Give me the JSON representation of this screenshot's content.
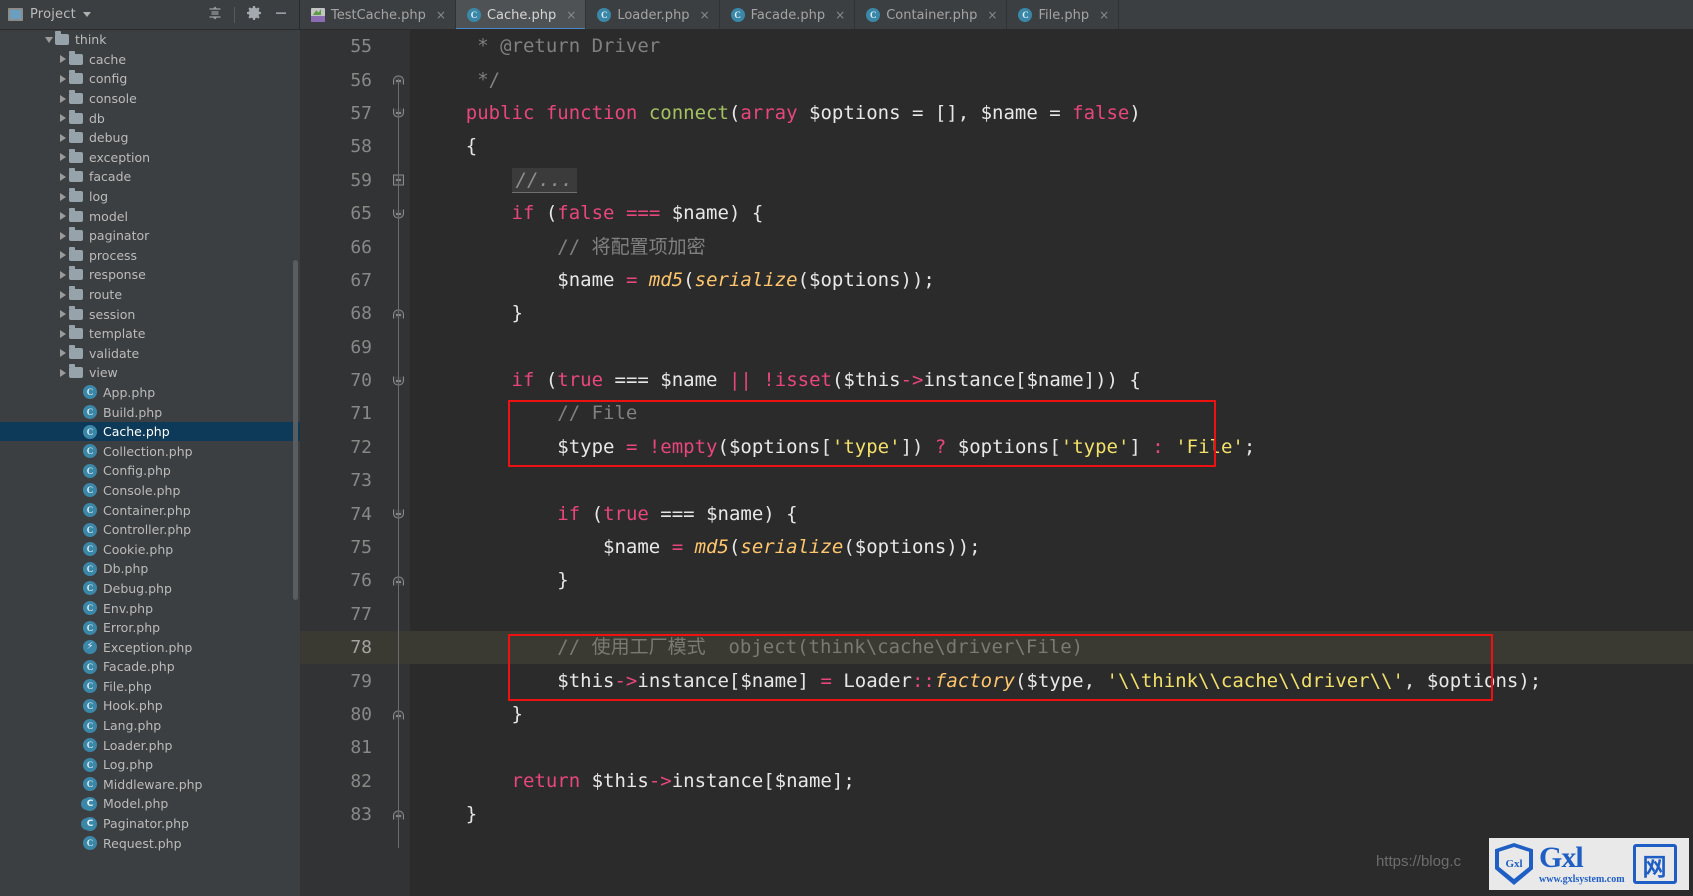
{
  "window": {
    "project_panel_title": "Project",
    "toolbar_icons": [
      "collapse-all-icon",
      "settings-gear-icon",
      "hide-panel-icon"
    ]
  },
  "tabs": [
    {
      "label": "TestCache.php",
      "icon": "php-file-icon",
      "active": false,
      "close": "×"
    },
    {
      "label": "Cache.php",
      "icon": "php-class-icon",
      "active": true,
      "close": "×"
    },
    {
      "label": "Loader.php",
      "icon": "php-class-icon",
      "active": false,
      "close": "×"
    },
    {
      "label": "Facade.php",
      "icon": "php-class-icon",
      "active": false,
      "close": "×"
    },
    {
      "label": "Container.php",
      "icon": "php-class-icon",
      "active": false,
      "close": "×"
    },
    {
      "label": "File.php",
      "icon": "php-class-icon",
      "active": false,
      "close": "×"
    }
  ],
  "sidebar": {
    "items": [
      {
        "label": "think",
        "kind": "folder",
        "indent": 3,
        "expanded": true,
        "selected": false
      },
      {
        "label": "cache",
        "kind": "folder",
        "indent": 4,
        "expanded": false,
        "selected": false
      },
      {
        "label": "config",
        "kind": "folder",
        "indent": 4,
        "expanded": false,
        "selected": false
      },
      {
        "label": "console",
        "kind": "folder",
        "indent": 4,
        "expanded": false,
        "selected": false
      },
      {
        "label": "db",
        "kind": "folder",
        "indent": 4,
        "expanded": false,
        "selected": false
      },
      {
        "label": "debug",
        "kind": "folder",
        "indent": 4,
        "expanded": false,
        "selected": false
      },
      {
        "label": "exception",
        "kind": "folder",
        "indent": 4,
        "expanded": false,
        "selected": false
      },
      {
        "label": "facade",
        "kind": "folder",
        "indent": 4,
        "expanded": false,
        "selected": false
      },
      {
        "label": "log",
        "kind": "folder",
        "indent": 4,
        "expanded": false,
        "selected": false
      },
      {
        "label": "model",
        "kind": "folder",
        "indent": 4,
        "expanded": false,
        "selected": false
      },
      {
        "label": "paginator",
        "kind": "folder",
        "indent": 4,
        "expanded": false,
        "selected": false
      },
      {
        "label": "process",
        "kind": "folder",
        "indent": 4,
        "expanded": false,
        "selected": false
      },
      {
        "label": "response",
        "kind": "folder",
        "indent": 4,
        "expanded": false,
        "selected": false
      },
      {
        "label": "route",
        "kind": "folder",
        "indent": 4,
        "expanded": false,
        "selected": false
      },
      {
        "label": "session",
        "kind": "folder",
        "indent": 4,
        "expanded": false,
        "selected": false
      },
      {
        "label": "template",
        "kind": "folder",
        "indent": 4,
        "expanded": false,
        "selected": false
      },
      {
        "label": "validate",
        "kind": "folder",
        "indent": 4,
        "expanded": false,
        "selected": false
      },
      {
        "label": "view",
        "kind": "folder",
        "indent": 4,
        "expanded": false,
        "selected": false
      },
      {
        "label": "App.php",
        "kind": "class",
        "indent": 5,
        "selected": false
      },
      {
        "label": "Build.php",
        "kind": "class",
        "indent": 5,
        "selected": false
      },
      {
        "label": "Cache.php",
        "kind": "class",
        "indent": 5,
        "selected": true
      },
      {
        "label": "Collection.php",
        "kind": "class",
        "indent": 5,
        "selected": false
      },
      {
        "label": "Config.php",
        "kind": "class",
        "indent": 5,
        "selected": false
      },
      {
        "label": "Console.php",
        "kind": "class",
        "indent": 5,
        "selected": false
      },
      {
        "label": "Container.php",
        "kind": "class",
        "indent": 5,
        "selected": false
      },
      {
        "label": "Controller.php",
        "kind": "class",
        "indent": 5,
        "selected": false
      },
      {
        "label": "Cookie.php",
        "kind": "class",
        "indent": 5,
        "selected": false
      },
      {
        "label": "Db.php",
        "kind": "class",
        "indent": 5,
        "selected": false
      },
      {
        "label": "Debug.php",
        "kind": "class",
        "indent": 5,
        "selected": false
      },
      {
        "label": "Env.php",
        "kind": "class",
        "indent": 5,
        "selected": false
      },
      {
        "label": "Error.php",
        "kind": "class",
        "indent": 5,
        "selected": false
      },
      {
        "label": "Exception.php",
        "kind": "exception",
        "indent": 5,
        "selected": false
      },
      {
        "label": "Facade.php",
        "kind": "class",
        "indent": 5,
        "selected": false
      },
      {
        "label": "File.php",
        "kind": "class",
        "indent": 5,
        "selected": false
      },
      {
        "label": "Hook.php",
        "kind": "class",
        "indent": 5,
        "selected": false
      },
      {
        "label": "Lang.php",
        "kind": "class",
        "indent": 5,
        "selected": false
      },
      {
        "label": "Loader.php",
        "kind": "class",
        "indent": 5,
        "selected": false
      },
      {
        "label": "Log.php",
        "kind": "class",
        "indent": 5,
        "selected": false
      },
      {
        "label": "Middleware.php",
        "kind": "class",
        "indent": 5,
        "selected": false
      },
      {
        "label": "Model.php",
        "kind": "abstract",
        "indent": 5,
        "selected": false
      },
      {
        "label": "Paginator.php",
        "kind": "abstract",
        "indent": 5,
        "selected": false
      },
      {
        "label": "Request.php",
        "kind": "class",
        "indent": 5,
        "selected": false
      }
    ]
  },
  "editor": {
    "file": "Cache.php",
    "current_line": 78,
    "lines": [
      {
        "num": "55",
        "fold": "line",
        "tokens": [
          {
            "t": "     * @return Driver",
            "c": "cmt"
          }
        ]
      },
      {
        "num": "56",
        "fold": "cap",
        "tokens": [
          {
            "t": "     */",
            "c": "cmt"
          }
        ]
      },
      {
        "num": "57",
        "fold": "capdown",
        "tokens": [
          {
            "t": "    ",
            "c": "plain"
          },
          {
            "t": "public",
            "c": "kw2"
          },
          {
            "t": " ",
            "c": "plain"
          },
          {
            "t": "function",
            "c": "kw2"
          },
          {
            "t": " ",
            "c": "plain"
          },
          {
            "t": "connect",
            "c": "fn"
          },
          {
            "t": "(",
            "c": "punct"
          },
          {
            "t": "array",
            "c": "kw2"
          },
          {
            "t": " ",
            "c": "plain"
          },
          {
            "t": "$options",
            "c": "var"
          },
          {
            "t": " = [], ",
            "c": "punct"
          },
          {
            "t": "$name",
            "c": "var"
          },
          {
            "t": " = ",
            "c": "punct"
          },
          {
            "t": "false",
            "c": "kw2"
          },
          {
            "t": ")",
            "c": "punct"
          }
        ]
      },
      {
        "num": "58",
        "fold": "none",
        "tokens": [
          {
            "t": "    {",
            "c": "punct"
          }
        ]
      },
      {
        "num": "59",
        "fold": "plus",
        "tokens": [
          {
            "t": "        ",
            "c": "plain"
          },
          {
            "t": "//...",
            "c": "foldph"
          }
        ]
      },
      {
        "num": "65",
        "fold": "capdown",
        "tokens": [
          {
            "t": "        ",
            "c": "plain"
          },
          {
            "t": "if",
            "c": "kw2"
          },
          {
            "t": " (",
            "c": "punct"
          },
          {
            "t": "false",
            "c": "kw2"
          },
          {
            "t": " ",
            "c": "plain"
          },
          {
            "t": "===",
            "c": "kw2"
          },
          {
            "t": " ",
            "c": "plain"
          },
          {
            "t": "$name",
            "c": "var"
          },
          {
            "t": ") {",
            "c": "punct"
          }
        ]
      },
      {
        "num": "66",
        "fold": "none",
        "tokens": [
          {
            "t": "            // 将配置项加密",
            "c": "cmt"
          }
        ]
      },
      {
        "num": "67",
        "fold": "none",
        "tokens": [
          {
            "t": "            ",
            "c": "plain"
          },
          {
            "t": "$name",
            "c": "var"
          },
          {
            "t": " ",
            "c": "plain"
          },
          {
            "t": "=",
            "c": "kw2"
          },
          {
            "t": " ",
            "c": "plain"
          },
          {
            "t": "md5",
            "c": "meth italic"
          },
          {
            "t": "(",
            "c": "punct"
          },
          {
            "t": "serialize",
            "c": "meth italic"
          },
          {
            "t": "(",
            "c": "punct"
          },
          {
            "t": "$options",
            "c": "var"
          },
          {
            "t": "));",
            "c": "punct"
          }
        ]
      },
      {
        "num": "68",
        "fold": "cap",
        "tokens": [
          {
            "t": "        }",
            "c": "punct"
          }
        ]
      },
      {
        "num": "69",
        "fold": "none",
        "tokens": [
          {
            "t": "",
            "c": "plain"
          }
        ]
      },
      {
        "num": "70",
        "fold": "capdown",
        "tokens": [
          {
            "t": "        ",
            "c": "plain"
          },
          {
            "t": "if",
            "c": "kw2"
          },
          {
            "t": " (",
            "c": "punct"
          },
          {
            "t": "true",
            "c": "kw2"
          },
          {
            "t": " ",
            "c": "plain"
          },
          {
            "t": "===",
            "c": "plain"
          },
          {
            "t": " ",
            "c": "plain"
          },
          {
            "t": "$name",
            "c": "var"
          },
          {
            "t": " ",
            "c": "plain"
          },
          {
            "t": "||",
            "c": "kw2"
          },
          {
            "t": " ",
            "c": "plain"
          },
          {
            "t": "!",
            "c": "kw2"
          },
          {
            "t": "isset",
            "c": "kw2"
          },
          {
            "t": "(",
            "c": "punct"
          },
          {
            "t": "$this",
            "c": "var"
          },
          {
            "t": "->",
            "c": "kw2"
          },
          {
            "t": "instance",
            "c": "plain"
          },
          {
            "t": "[",
            "c": "punct"
          },
          {
            "t": "$name",
            "c": "var"
          },
          {
            "t": "])) {",
            "c": "punct"
          }
        ]
      },
      {
        "num": "71",
        "fold": "none",
        "tokens": [
          {
            "t": "            // File",
            "c": "cmt"
          }
        ]
      },
      {
        "num": "72",
        "fold": "none",
        "tokens": [
          {
            "t": "            ",
            "c": "plain"
          },
          {
            "t": "$type",
            "c": "var"
          },
          {
            "t": " ",
            "c": "plain"
          },
          {
            "t": "=",
            "c": "kw2"
          },
          {
            "t": " ",
            "c": "plain"
          },
          {
            "t": "!",
            "c": "kw2"
          },
          {
            "t": "empty",
            "c": "kw2"
          },
          {
            "t": "(",
            "c": "punct"
          },
          {
            "t": "$options",
            "c": "var"
          },
          {
            "t": "[",
            "c": "punct"
          },
          {
            "t": "'type'",
            "c": "str"
          },
          {
            "t": "]) ",
            "c": "punct"
          },
          {
            "t": "?",
            "c": "kw2"
          },
          {
            "t": " ",
            "c": "plain"
          },
          {
            "t": "$options",
            "c": "var"
          },
          {
            "t": "[",
            "c": "punct"
          },
          {
            "t": "'type'",
            "c": "str"
          },
          {
            "t": "] ",
            "c": "punct"
          },
          {
            "t": ":",
            "c": "kw2"
          },
          {
            "t": " ",
            "c": "plain"
          },
          {
            "t": "'File'",
            "c": "str"
          },
          {
            "t": ";",
            "c": "punct"
          }
        ]
      },
      {
        "num": "73",
        "fold": "none",
        "tokens": [
          {
            "t": "",
            "c": "plain"
          }
        ]
      },
      {
        "num": "74",
        "fold": "capdown",
        "tokens": [
          {
            "t": "            ",
            "c": "plain"
          },
          {
            "t": "if",
            "c": "kw2"
          },
          {
            "t": " (",
            "c": "punct"
          },
          {
            "t": "true",
            "c": "kw2"
          },
          {
            "t": " ",
            "c": "plain"
          },
          {
            "t": "===",
            "c": "plain"
          },
          {
            "t": " ",
            "c": "plain"
          },
          {
            "t": "$name",
            "c": "var"
          },
          {
            "t": ") {",
            "c": "punct"
          }
        ]
      },
      {
        "num": "75",
        "fold": "none",
        "tokens": [
          {
            "t": "                ",
            "c": "plain"
          },
          {
            "t": "$name",
            "c": "var"
          },
          {
            "t": " ",
            "c": "plain"
          },
          {
            "t": "=",
            "c": "kw2"
          },
          {
            "t": " ",
            "c": "plain"
          },
          {
            "t": "md5",
            "c": "meth italic"
          },
          {
            "t": "(",
            "c": "punct"
          },
          {
            "t": "serialize",
            "c": "meth italic"
          },
          {
            "t": "(",
            "c": "punct"
          },
          {
            "t": "$options",
            "c": "var"
          },
          {
            "t": "));",
            "c": "punct"
          }
        ]
      },
      {
        "num": "76",
        "fold": "cap",
        "tokens": [
          {
            "t": "            }",
            "c": "punct"
          }
        ]
      },
      {
        "num": "77",
        "fold": "none",
        "tokens": [
          {
            "t": "",
            "c": "plain"
          }
        ]
      },
      {
        "num": "78",
        "fold": "none",
        "tokens": [
          {
            "t": "            // 使用工厂模式  object(think\\cache\\driver\\File)",
            "c": "cmt2"
          }
        ]
      },
      {
        "num": "79",
        "fold": "none",
        "tokens": [
          {
            "t": "            ",
            "c": "plain"
          },
          {
            "t": "$this",
            "c": "var"
          },
          {
            "t": "->",
            "c": "kw2"
          },
          {
            "t": "instance",
            "c": "plain"
          },
          {
            "t": "[",
            "c": "punct"
          },
          {
            "t": "$name",
            "c": "var"
          },
          {
            "t": "] ",
            "c": "punct"
          },
          {
            "t": "=",
            "c": "kw2"
          },
          {
            "t": " ",
            "c": "plain"
          },
          {
            "t": "Loader",
            "c": "plain"
          },
          {
            "t": "::",
            "c": "kw2"
          },
          {
            "t": "factory",
            "c": "meth italic"
          },
          {
            "t": "(",
            "c": "punct"
          },
          {
            "t": "$type",
            "c": "var"
          },
          {
            "t": ", ",
            "c": "punct"
          },
          {
            "t": "'\\\\think\\\\cache\\\\driver\\\\'",
            "c": "str"
          },
          {
            "t": ", ",
            "c": "punct"
          },
          {
            "t": "$options",
            "c": "var"
          },
          {
            "t": ");",
            "c": "punct"
          }
        ]
      },
      {
        "num": "80",
        "fold": "cap",
        "tokens": [
          {
            "t": "        }",
            "c": "punct"
          }
        ]
      },
      {
        "num": "81",
        "fold": "none",
        "tokens": [
          {
            "t": "",
            "c": "plain"
          }
        ]
      },
      {
        "num": "82",
        "fold": "none",
        "tokens": [
          {
            "t": "        ",
            "c": "plain"
          },
          {
            "t": "return",
            "c": "kw2"
          },
          {
            "t": " ",
            "c": "plain"
          },
          {
            "t": "$this",
            "c": "var"
          },
          {
            "t": "->",
            "c": "kw2"
          },
          {
            "t": "instance",
            "c": "plain"
          },
          {
            "t": "[",
            "c": "punct"
          },
          {
            "t": "$name",
            "c": "var"
          },
          {
            "t": "];",
            "c": "punct"
          }
        ]
      },
      {
        "num": "83",
        "fold": "cap",
        "tokens": [
          {
            "t": "    }",
            "c": "punct"
          }
        ]
      }
    ],
    "annotations": [
      {
        "name": "highlight-box-type-assignment",
        "color": "#ee1111",
        "covers_lines": [
          "71",
          "72"
        ]
      },
      {
        "name": "highlight-box-factory-call",
        "color": "#ee1111",
        "covers_lines": [
          "78",
          "79"
        ]
      }
    ]
  },
  "watermark": {
    "url_text": "https://blog.c",
    "logo_shield_text": "Gxl",
    "logo_main": "Gxl",
    "logo_cn": "网",
    "logo_sub": "www.gxlsystem.com"
  },
  "colors": {
    "accent": "#4a88c7",
    "selection": "#0d3a58",
    "highlight_box": "#ee1111",
    "editor_bg": "#2b2b2b",
    "panel_bg": "#3c3f41",
    "current_line": "#3a3a32"
  }
}
